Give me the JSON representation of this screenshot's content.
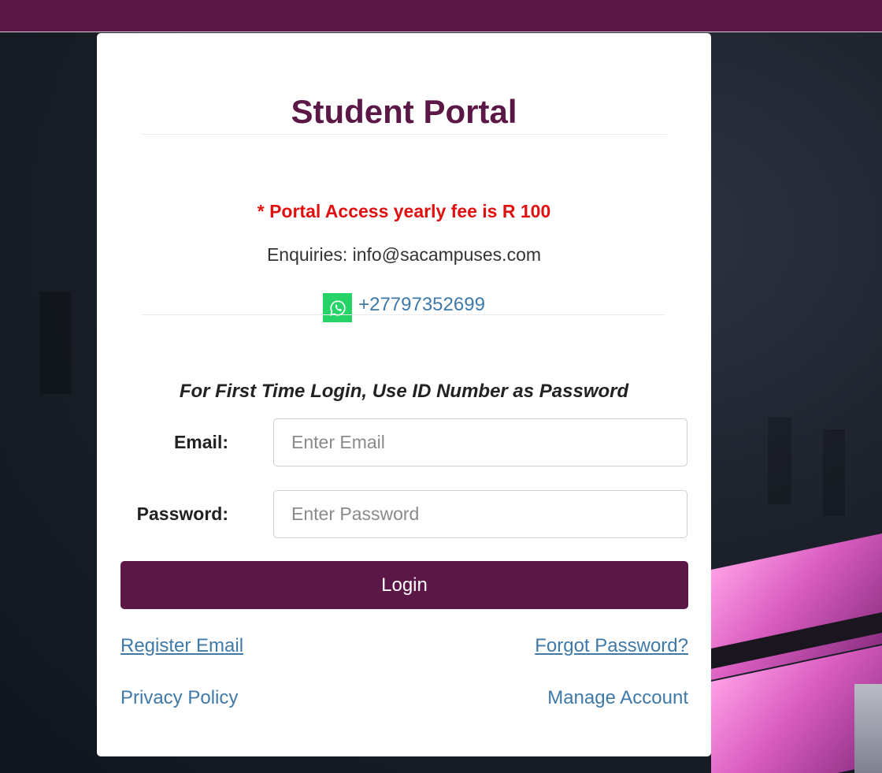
{
  "colors": {
    "brand": "#5b1847",
    "alert": "#e01010",
    "link": "#3f79a8",
    "whatsapp": "#25d366"
  },
  "portal": {
    "title": "Student Portal",
    "fee_note": "* Portal Access yearly fee is R 100",
    "enquiries": "Enquiries: info@sacampuses.com",
    "whatsapp": {
      "icon": "whatsapp-icon",
      "number": "+27797352699"
    },
    "first_login_note": "For First Time Login, Use ID Number as Password"
  },
  "form": {
    "email_label": "Email:",
    "email_placeholder": "Enter Email",
    "email_value": "",
    "password_label": "Password:",
    "password_placeholder": "Enter Password",
    "password_value": "",
    "login_label": "Login"
  },
  "links": {
    "register_email": "Register Email",
    "forgot_password": "Forgot Password?",
    "privacy_policy": "Privacy Policy",
    "manage_account": "Manage Account"
  }
}
